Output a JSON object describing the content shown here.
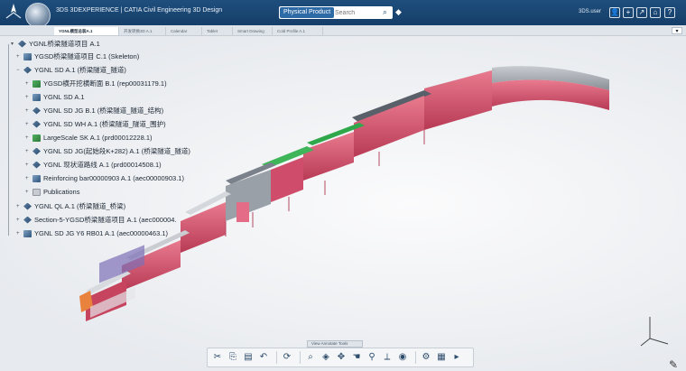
{
  "topbar": {
    "app_title": "3DS 3DEXPERIENCE | CATIA Civil Engineering 3D Design",
    "search_chip": "Physical Product",
    "search_placeholder": "Search",
    "user_name": "3DS.user",
    "icons": [
      "compass-icon",
      "share-icon",
      "help-icon"
    ]
  },
  "tabs": [
    {
      "label": "YGNL模型总装A.1",
      "active": true
    },
    {
      "label": "开发转换3D A.1",
      "active": false
    },
    {
      "label": "Calendar",
      "active": false
    },
    {
      "label": "Tablet",
      "active": false
    },
    {
      "label": "Smart Drawing",
      "active": false
    },
    {
      "label": "Cold Profile A.1",
      "active": false
    }
  ],
  "tree": {
    "root": "YGNL桥梁隧道项目 A.1",
    "items": [
      {
        "label": "YGSD桥梁隧道项目 C.1 (Skeleton)",
        "icon": "skeleton-icon",
        "level": 1
      },
      {
        "label": "YGNL SD A.1 (桥梁隧道_隧道)",
        "icon": "product-icon",
        "level": 1
      },
      {
        "label": "YGSD横开挖横断面 B.1 (rep00031179.1)",
        "icon": "shape-icon",
        "level": 2
      },
      {
        "label": "YGNL SD A.1",
        "icon": "part-icon",
        "level": 2
      },
      {
        "label": "YGNL SD JG B.1 (桥梁隧道_隧道_结构)",
        "icon": "product-icon",
        "level": 2
      },
      {
        "label": "YGNL SD WH A.1 (桥梁隧道_隧道_围护)",
        "icon": "product-icon",
        "level": 2
      },
      {
        "label": "LargeScale SK A.1 (prd00012228.1)",
        "icon": "shape-icon",
        "level": 2
      },
      {
        "label": "YGNL SD JG(起始段K+282) A.1 (桥梁隧道_隧道)",
        "icon": "product-icon",
        "level": 2
      },
      {
        "label": "YGNL 现状道路线 A.1 (prd00014508.1)",
        "icon": "product-icon",
        "level": 2
      },
      {
        "label": "Reinforcing bar00000903 A.1 (aec00000903.1)",
        "icon": "part-icon",
        "level": 2
      },
      {
        "label": "Publications",
        "icon": "folder-icon",
        "level": 2
      },
      {
        "label": "YGNL QL A.1 (桥梁隧道_桥梁)",
        "icon": "product-icon",
        "level": 1
      },
      {
        "label": "Section-5-YGSD桥梁隧道项目 A.1 (aec000004.",
        "icon": "product-icon",
        "level": 1
      },
      {
        "label": "YGNL SD JG Y6 RB01 A.1 (aec00000463.1)",
        "icon": "part-icon",
        "level": 1
      }
    ]
  },
  "bottom": {
    "section_tabs": "View  Annotate  Tools",
    "tools": [
      "cut-icon",
      "copy-icon",
      "paste-icon",
      "undo-icon",
      "sep",
      "rotate-icon",
      "sep",
      "zoom-icon",
      "view-icon",
      "move-icon",
      "pan-icon",
      "search-icon",
      "measure-icon",
      "render-icon",
      "sep",
      "settings-icon",
      "grid-icon",
      "more-icon"
    ]
  },
  "colors": {
    "accent": "#1f4e7d",
    "tunnel": "#d9546e",
    "steel": "#8a8f97",
    "rebar": "#2fa74b"
  }
}
